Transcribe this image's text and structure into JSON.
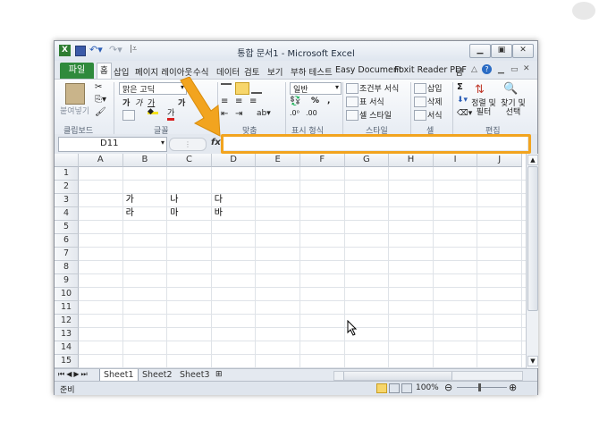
{
  "window": {
    "title": "통합 문서1 - Microsoft Excel",
    "colors": {
      "file_tab": "#2f8a3c",
      "highlight": "#f2a41f",
      "title_bg": "#dfe6ef"
    }
  },
  "tabs": {
    "file": "파일",
    "items": [
      "홈",
      "삽입",
      "페이지 레이아웃",
      "수식",
      "데이터",
      "검토",
      "보기",
      "부하 테스트",
      "Easy Document",
      "Foxit Reader PDF",
      "팀"
    ]
  },
  "ribbon": {
    "clipboard": {
      "paste": "붙여넣기",
      "label": "클립보드"
    },
    "font": {
      "name": "맑은 고딕",
      "bold": "가",
      "italic": "가",
      "underline": "가",
      "grow": "가",
      "fontcolor": "가",
      "label": "글꼴"
    },
    "align": {
      "label": "맞춤"
    },
    "number": {
      "format": "일반",
      "percent": "%",
      "comma": ",",
      "label": "표시 형식"
    },
    "style": {
      "conditional": "조건부 서식",
      "table": "표 서식",
      "cell": "셀 스타일",
      "label": "스타일"
    },
    "cells": {
      "insert": "삽입",
      "delete": "삭제",
      "format": "서식",
      "label": "셀"
    },
    "edit": {
      "sum": "Σ",
      "sort": "정렬 및 필터",
      "find": "찾기 및 선택",
      "label": "편집"
    }
  },
  "formula_bar": {
    "name_box": "D11",
    "fx": "fx",
    "value": ""
  },
  "grid": {
    "columns": [
      "A",
      "B",
      "C",
      "D",
      "E",
      "F",
      "G",
      "H",
      "I",
      "J"
    ],
    "rows": [
      "1",
      "2",
      "3",
      "4",
      "5",
      "6",
      "7",
      "8",
      "9",
      "10",
      "11",
      "12",
      "13",
      "14",
      "15"
    ],
    "cells": {
      "B3": "가",
      "C3": "나",
      "D3": "다",
      "B4": "라",
      "C4": "마",
      "D4": "바"
    }
  },
  "sheets": [
    "Sheet1",
    "Sheet2",
    "Sheet3"
  ],
  "status": {
    "ready": "준비",
    "zoom": "100%"
  },
  "icons": [
    "excel-icon",
    "save-icon",
    "undo-icon",
    "redo-icon",
    "help-icon",
    "arrow-annotation"
  ]
}
